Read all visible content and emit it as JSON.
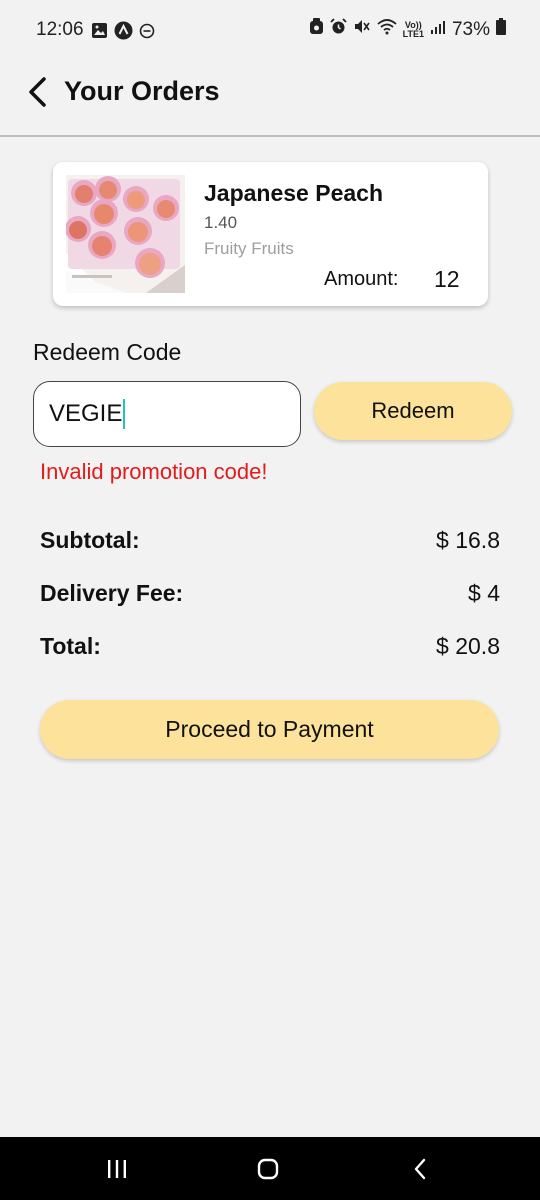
{
  "status_bar": {
    "time": "12:06",
    "battery": "73%",
    "left_icons": [
      "image-icon",
      "app-icon",
      "minus-circle-icon"
    ],
    "right_icons": [
      "notification-icon",
      "alarm-icon",
      "mute-icon",
      "wifi-icon",
      "volte-icon",
      "signal-icon",
      "battery-icon"
    ],
    "network_top": "Vo))",
    "network_bottom": "LTE1"
  },
  "header": {
    "title": "Your Orders"
  },
  "order": {
    "name": "Japanese Peach",
    "price": "1.40",
    "shop": "Fruity Fruits",
    "amount_label": "Amount:",
    "amount_value": "12"
  },
  "redeem": {
    "heading": "Redeem Code",
    "code_value": "VEGIE",
    "button_label": "Redeem",
    "error": "Invalid promotion code!"
  },
  "summary": {
    "subtotal_label": "Subtotal:",
    "subtotal_value": "$ 16.8",
    "delivery_label": "Delivery Fee:",
    "delivery_value": "$ 4",
    "total_label": "Total:",
    "total_value": "$ 20.8"
  },
  "actions": {
    "proceed_label": "Proceed to Payment"
  },
  "colors": {
    "background": "#f2f2f2",
    "accent_button": "#fce29a",
    "error": "#e41b1b",
    "caret": "#1ec6b8"
  }
}
